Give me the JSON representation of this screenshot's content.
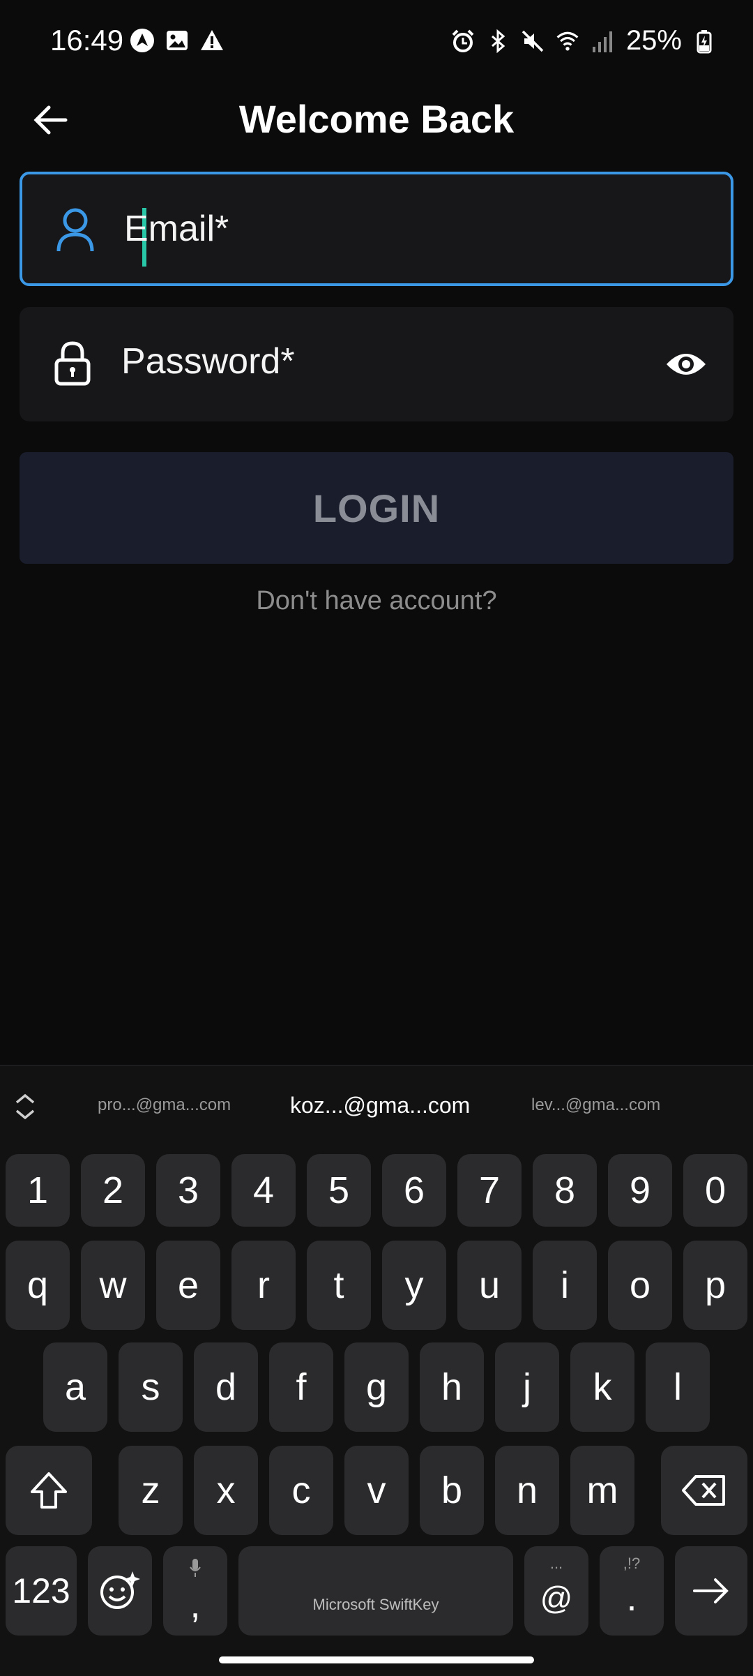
{
  "status_bar": {
    "time": "16:49",
    "battery": "25%",
    "left_icons": [
      "navigation-icon",
      "gallery-icon",
      "alert-icon"
    ],
    "right_icons": [
      "alarm-icon",
      "bluetooth-icon",
      "mute-icon",
      "wifi-icon",
      "signal-icon",
      "battery-charging-icon"
    ]
  },
  "header": {
    "title": "Welcome Back",
    "back_icon": "back-arrow-icon"
  },
  "form": {
    "email": {
      "placeholder": "Email*",
      "value": "",
      "icon": "person-icon",
      "focused": true
    },
    "password": {
      "placeholder": "Password*",
      "value": "",
      "icon": "lock-icon",
      "toggle_icon": "eye-icon"
    },
    "login_label": "LOGIN",
    "signup_text": "Don't have account?"
  },
  "colors": {
    "background": "#0b0b0c",
    "field_bg": "#17171a",
    "focus_border": "#3b98e6",
    "caret": "#28c7a7",
    "login_bg": "#1a1d2c",
    "login_text": "#8a8c96",
    "muted_text": "#8d8d8d"
  },
  "keyboard": {
    "name": "Microsoft SwiftKey",
    "suggestions": [
      "pro...@gma...com",
      "koz...@gma...com",
      "lev...@gma...com"
    ],
    "row_numbers": [
      "1",
      "2",
      "3",
      "4",
      "5",
      "6",
      "7",
      "8",
      "9",
      "0"
    ],
    "row_1": [
      "q",
      "w",
      "e",
      "r",
      "t",
      "y",
      "u",
      "i",
      "o",
      "p"
    ],
    "row_2": [
      "a",
      "s",
      "d",
      "f",
      "g",
      "h",
      "j",
      "k",
      "l"
    ],
    "row_3": [
      "z",
      "x",
      "c",
      "v",
      "b",
      "n",
      "m"
    ],
    "bottom": {
      "numbers_label": "123",
      "comma": ",",
      "at": "@",
      "at_sub": "...",
      "period": ".",
      "period_sub": ",!?"
    }
  }
}
